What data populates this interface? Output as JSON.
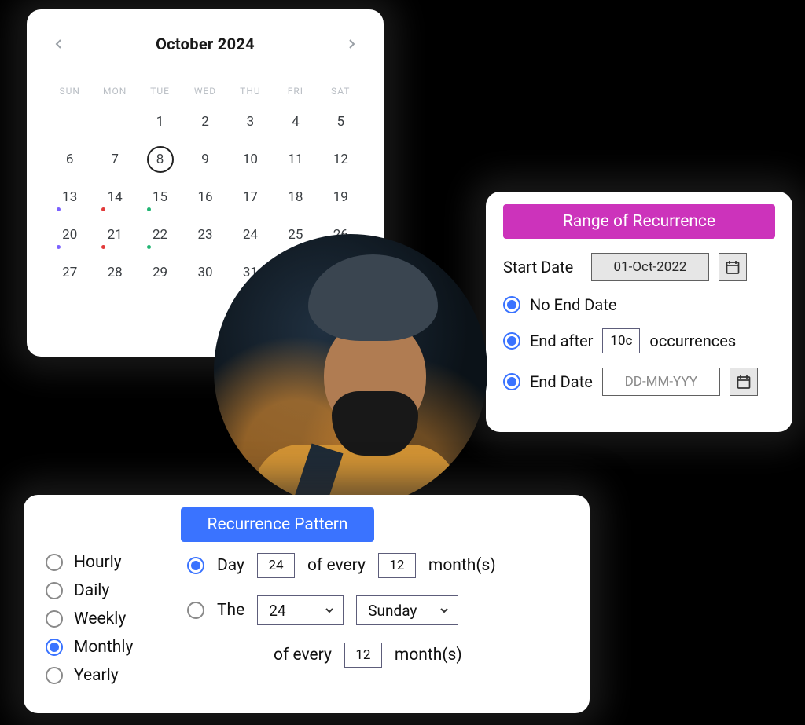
{
  "calendar": {
    "title": "October 2024",
    "dow": [
      "SUN",
      "MON",
      "TUE",
      "WED",
      "THU",
      "FRI",
      "SAT"
    ],
    "days": [
      [
        null,
        null,
        1,
        2,
        3,
        4,
        5
      ],
      [
        6,
        7,
        8,
        9,
        10,
        11,
        12
      ],
      [
        13,
        14,
        15,
        16,
        17,
        18,
        19
      ],
      [
        20,
        21,
        22,
        23,
        24,
        25,
        26
      ],
      [
        27,
        28,
        29,
        30,
        31,
        null,
        null
      ]
    ],
    "today": 8,
    "dots": {
      "13": [
        "#7b61ff"
      ],
      "14": [
        "#e23b3b"
      ],
      "15": [
        "#22b573"
      ],
      "20": [
        "#7b61ff"
      ],
      "21": [
        "#e23b3b"
      ],
      "22": [
        "#22b573"
      ]
    }
  },
  "range": {
    "title": "Range of Recurrence",
    "start_label": "Start Date",
    "start_value": "01-Oct-2022",
    "no_end_label": "No End Date",
    "end_after_label": "End after",
    "occurrences_value": "10c",
    "occurrences_label": "occurrences",
    "end_date_label": "End Date",
    "end_date_placeholder": "DD-MM-YYY"
  },
  "pattern": {
    "title": "Recurrence Pattern",
    "options": [
      "Hourly",
      "Daily",
      "Weekly",
      "Monthly",
      "Yearly"
    ],
    "selected_option": "Monthly",
    "day_label": "Day",
    "day_num": "24",
    "of_every": "of every",
    "months1": "12",
    "months_suffix": "month(s)",
    "the_label": "The",
    "week_num": "24",
    "weekday": "Sunday",
    "months2": "12"
  }
}
